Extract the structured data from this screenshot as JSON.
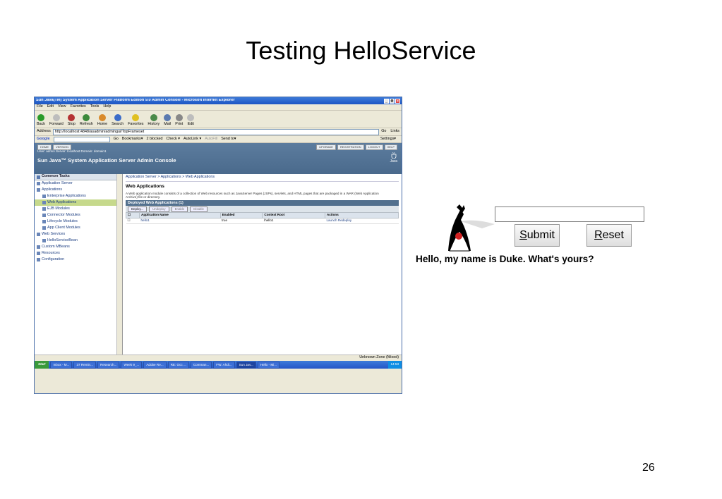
{
  "slide": {
    "title": "Testing HelloService",
    "page_number": "26"
  },
  "browser": {
    "title": "Sun Java(TM) System Application Server Platform Edition 9.0 Admin Console - Microsoft Internet Explorer",
    "window_buttons": [
      "_",
      "Θ",
      "×"
    ],
    "menu": [
      "File",
      "Edit",
      "View",
      "Favorites",
      "Tools",
      "Help"
    ],
    "toolbar": [
      {
        "label": "Back",
        "color": "#2a9b2a"
      },
      {
        "label": "Forward",
        "color": "#bdbdbd"
      },
      {
        "label": "Stop",
        "color": "#b43232"
      },
      {
        "label": "Refresh",
        "color": "#3c8a3c"
      },
      {
        "label": "Home",
        "color": "#d98a2a"
      },
      {
        "label": "Search",
        "color": "#3b6cc9"
      },
      {
        "label": "Favorites",
        "color": "#e0c020"
      },
      {
        "label": "History",
        "color": "#4a8a4a"
      },
      {
        "label": "Mail",
        "color": "#5a7ab0"
      },
      {
        "label": "Print",
        "color": "#888888"
      },
      {
        "label": "Edit",
        "color": "#bdbdbd"
      }
    ],
    "address_label": "Address",
    "address_value": "http://localhost:4848/asadmin/admingui/TopFrameset",
    "go_label": "Go",
    "links_label": "Links",
    "google_bar": [
      "Google",
      "Go",
      "Bookmarks▾",
      "2 blocked",
      "Check ▾",
      "AutoLink ▾",
      "AutoFill",
      "Send to▾",
      "Settings▾"
    ],
    "status_text": "Unknown Zone (Mixed)"
  },
  "console": {
    "mast_left": [
      "HOME",
      "VERSION"
    ],
    "mast_right": [
      "UPGRADE",
      "REGISTRATION",
      "LOGOUT",
      "HELP"
    ],
    "user_info": "User: admin   Server: localhost   Domain: domain1",
    "brand": "Sun Java™ System Application Server Admin Console",
    "java_logo": "Java",
    "common_tasks": "Common Tasks",
    "tree": [
      {
        "label": "Application Server",
        "level": 0,
        "icon": "server-icon"
      },
      {
        "label": "Applications",
        "level": 0,
        "icon": "folder-icon"
      },
      {
        "label": "Enterprise Applications",
        "level": 1,
        "icon": "app-icon"
      },
      {
        "label": "Web Applications",
        "level": 1,
        "icon": "app-icon",
        "selected": true
      },
      {
        "label": "EJB Modules",
        "level": 1,
        "icon": "app-icon"
      },
      {
        "label": "Connector Modules",
        "level": 1,
        "icon": "app-icon"
      },
      {
        "label": "Lifecycle Modules",
        "level": 1,
        "icon": "app-icon"
      },
      {
        "label": "App Client Modules",
        "level": 1,
        "icon": "app-icon"
      },
      {
        "label": "Web Services",
        "level": 0,
        "icon": "globe-icon"
      },
      {
        "label": "HelloServiceBean",
        "level": 1,
        "icon": "bean-icon"
      },
      {
        "label": "Custom MBeans",
        "level": 0,
        "icon": "mbean-icon"
      },
      {
        "label": "Resources",
        "level": 0,
        "icon": "folder-icon"
      },
      {
        "label": "Configuration",
        "level": 0,
        "icon": "config-icon"
      }
    ],
    "breadcrumb": "Application Server  >  Applications  >  Web Applications",
    "page_title": "Web Applications",
    "description": "A Web application module consists of a collection of Web resources such as JavaServer Pages (JSPs), servlets, and HTML pages that are packaged in a WAR (Web Application Archive) file or directory.",
    "table_title": "Deployed Web Applications (1)",
    "table_buttons": [
      "Deploy...",
      "Undeploy",
      "Enable",
      "Disable"
    ],
    "columns": [
      "Application Name",
      "Enabled",
      "Context Root",
      "Actions"
    ],
    "rows": [
      {
        "name": "hello1",
        "enabled": "true",
        "context_root": "/hello1",
        "actions": "Launch  Redeploy"
      }
    ]
  },
  "taskbar": {
    "start": "Start",
    "tasks": [
      "Inbox - M...",
      "37 Remin...",
      "Research...",
      "Week 9_...",
      "Adobe Re...",
      "RE: Occ ...",
      "Comman...",
      "FW: Ahdi...",
      "Sun Jav...",
      "Hello - Mi..."
    ],
    "clock": "14:53"
  },
  "hello_form": {
    "input_value": "",
    "submit_label": "Submit",
    "reset_label": "Reset",
    "greeting": "Hello, my name is Duke. What's yours?"
  }
}
